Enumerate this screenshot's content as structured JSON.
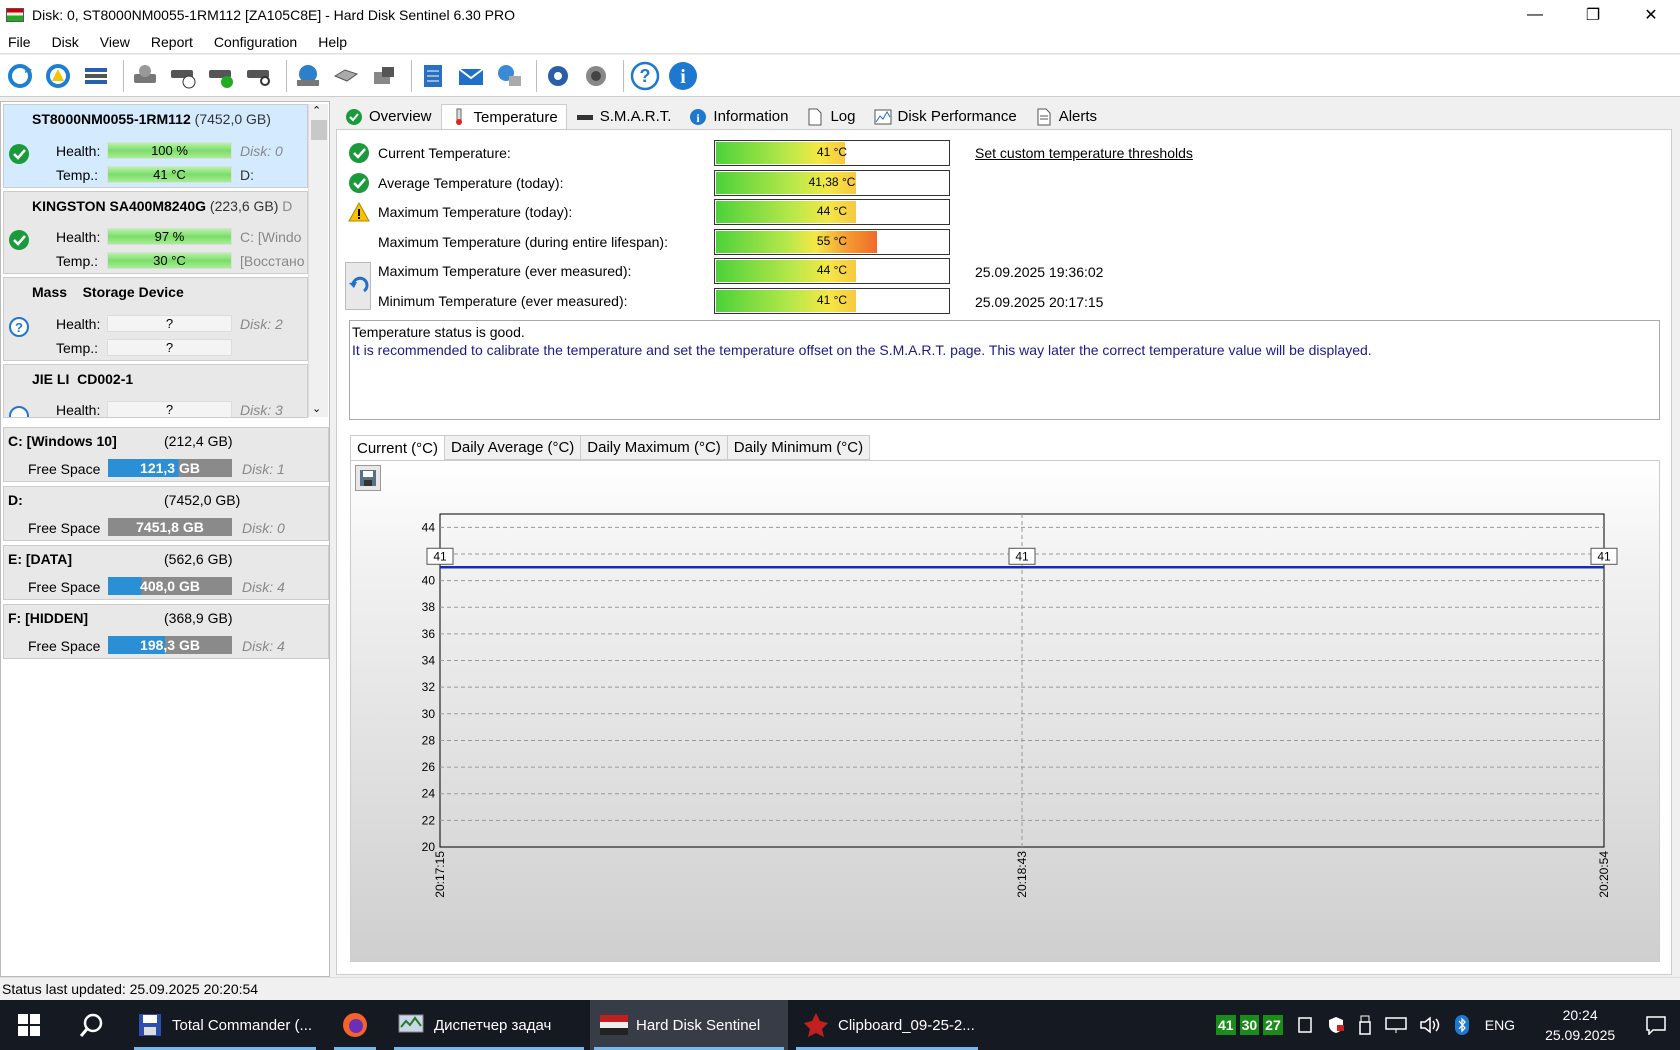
{
  "window": {
    "title": "Disk: 0, ST8000NM0055-1RM112 [ZA105C8E]  -  Hard Disk Sentinel 6.30 PRO"
  },
  "menu": [
    "File",
    "Disk",
    "View",
    "Report",
    "Configuration",
    "Help"
  ],
  "disks": [
    {
      "name": "ST8000NM0055-1RM112",
      "size": "(7452,0 GB)",
      "health_label": "Health:",
      "health": "100 %",
      "health_pct": 100,
      "temp_label": "Temp.:",
      "temp": "41 °C",
      "side1": "Disk: 0",
      "side2": "D:"
    },
    {
      "name": "KINGSTON SA400M8240G",
      "size": "(223,6 GB)",
      "size_cut": "D",
      "health_label": "Health:",
      "health": "97 %",
      "health_pct": 97,
      "temp_label": "Temp.:",
      "temp": "30 °C",
      "side1": "C: [Windo",
      "side2": "[Восстано"
    },
    {
      "name": "Mass    Storage Device",
      "health_label": "Health:",
      "health": "?",
      "temp_label": "Temp.:",
      "temp": "?",
      "side1": "Disk: 2"
    },
    {
      "name": "JIE LI  CD002-1",
      "health_label": "Health:",
      "health": "?",
      "side1": "Disk: 3"
    }
  ],
  "volumes": [
    {
      "name": "C: [Windows 10]",
      "size": "(212,4 GB)",
      "free_label": "Free Space",
      "free": "121,3 GB",
      "free_fraction": 0.571,
      "disk": "Disk: 1"
    },
    {
      "name": "D:",
      "size": "(7452,0 GB)",
      "free_label": "Free Space",
      "free": "7451,8 GB",
      "free_fraction": 1.0,
      "disk": "Disk: 0"
    },
    {
      "name": "E: [DATA]",
      "size": "(562,6 GB)",
      "free_label": "Free Space",
      "free": "408,0 GB",
      "free_fraction": 0.725,
      "disk": "Disk: 4"
    },
    {
      "name": "F: [HIDDEN]",
      "size": "(368,9 GB)",
      "free_label": "Free Space",
      "free": "198,3 GB",
      "free_fraction": 0.538,
      "disk": "Disk: 4"
    }
  ],
  "tabs": [
    "Overview",
    "Temperature",
    "S.M.A.R.T.",
    "Information",
    "Log",
    "Disk Performance",
    "Alerts"
  ],
  "temperature": {
    "rows": [
      {
        "label": "Current Temperature:",
        "value": "41 °C",
        "level": 0.55,
        "status": "ok"
      },
      {
        "label": "Average Temperature (today):",
        "value": "41,38 °C",
        "level": 0.6,
        "status": "ok"
      },
      {
        "label": "Maximum Temperature (today):",
        "value": "44 °C",
        "level": 0.6,
        "status": "warn"
      },
      {
        "label": "Maximum Temperature (during entire lifespan):",
        "value": "55 °C",
        "level": 0.74,
        "status": "none"
      },
      {
        "label": "Maximum Temperature (ever measured):",
        "value": "44 °C",
        "level": 0.6,
        "status": "none",
        "date": "25.09.2025 19:36:02"
      },
      {
        "label": "Minimum Temperature (ever measured):",
        "value": "41 °C",
        "level": 0.6,
        "status": "none",
        "date": "25.09.2025 20:17:15"
      }
    ],
    "link": "Set custom temperature thresholds",
    "message_line1": "Temperature status is good.",
    "message_line2": "It is recommended to calibrate the temperature and set the temperature offset on the S.M.A.R.T. page. This way later the correct temperature value will be displayed."
  },
  "chart_tabs": [
    "Current (°C)",
    "Daily Average (°C)",
    "Daily Maximum (°C)",
    "Daily Minimum (°C)"
  ],
  "chart_data": {
    "type": "line",
    "title": "",
    "xlabel": "",
    "ylabel": "",
    "x": [
      "20:17:15",
      "20:18:43",
      "20:20:54"
    ],
    "series": [
      {
        "values": [
          41,
          41,
          41
        ]
      }
    ],
    "point_labels": [
      "41",
      "41",
      "41"
    ],
    "yticks": [
      "20",
      "22",
      "24",
      "26",
      "28",
      "30",
      "32",
      "34",
      "36",
      "38",
      "40",
      "4",
      "44"
    ],
    "ylim": [
      20,
      45
    ],
    "grid": true,
    "line_color": "#1030b0"
  },
  "status": "Status last updated: 25.09.2025 20:20:54",
  "taskbar": {
    "items": [
      "Total Commander (...",
      "Диспетчер задач",
      "Hard Disk Sentinel",
      "Clipboard_09-25-2..."
    ],
    "tray_temps": [
      "41",
      "30",
      "27"
    ],
    "lang": "ENG",
    "time": "20:24",
    "date": "25.09.2025"
  }
}
